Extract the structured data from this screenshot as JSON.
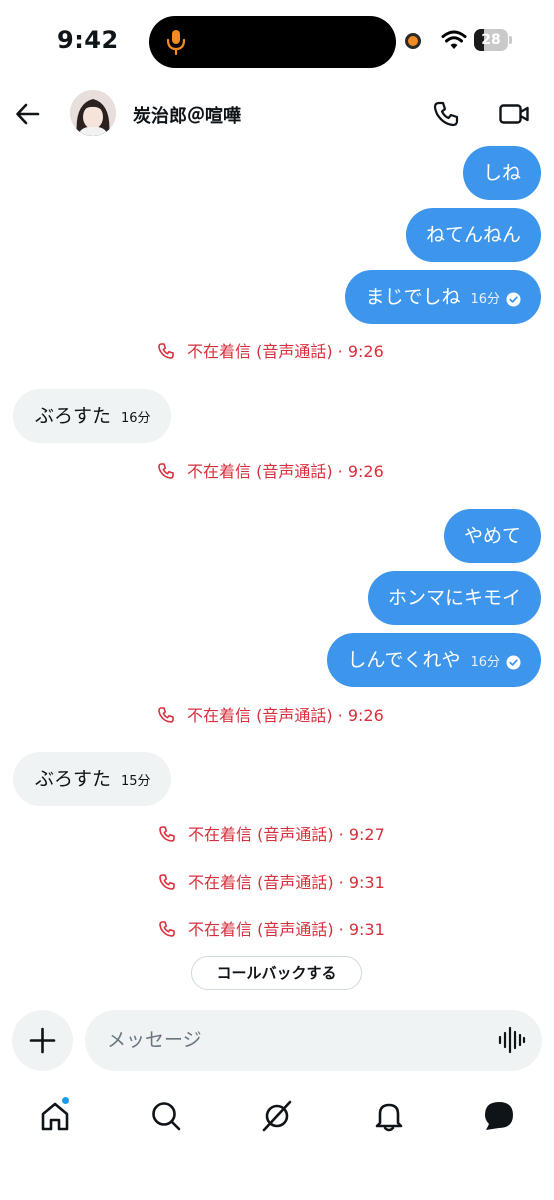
{
  "status_bar": {
    "time": "9:42",
    "battery": "28",
    "battery_level": 0.28
  },
  "header": {
    "contact_name": "炭治郎＠喧嘩"
  },
  "messages": [
    {
      "type": "sent",
      "text": "しね"
    },
    {
      "type": "sent",
      "text": "ねてんねん"
    },
    {
      "type": "sent",
      "text": "まじでしね",
      "time": "16分",
      "read": true
    },
    {
      "type": "missed",
      "text": "不在着信 (音声通話) · 9:26"
    },
    {
      "type": "received",
      "text": "ぶろすた",
      "time": "16分"
    },
    {
      "type": "missed",
      "text": "不在着信 (音声通話) · 9:26"
    },
    {
      "type": "sent",
      "text": "やめて"
    },
    {
      "type": "sent",
      "text": "ホンマにキモイ"
    },
    {
      "type": "sent",
      "text": "しんでくれや",
      "time": "16分",
      "read": true
    },
    {
      "type": "missed",
      "text": "不在着信 (音声通話) · 9:26"
    },
    {
      "type": "received",
      "text": "ぶろすた",
      "time": "15分"
    },
    {
      "type": "missed",
      "text": "不在着信 (音声通話) · 9:27"
    },
    {
      "type": "missed",
      "text": "不在着信 (音声通話) · 9:31"
    },
    {
      "type": "missed",
      "text": "不在着信 (音声通話) · 9:31"
    }
  ],
  "callback_label": "コールバックする",
  "composer": {
    "placeholder": "メッセージ"
  },
  "nav": {
    "items": [
      "home-icon",
      "search-icon",
      "grok-icon",
      "notifications-icon",
      "messages-icon"
    ],
    "home_has_badge": true
  },
  "colors": {
    "sent_bubble": "#3d96ec",
    "received_bubble": "#eff3f4",
    "missed_call": "#d6303c",
    "accent": "#1d9bf0"
  }
}
